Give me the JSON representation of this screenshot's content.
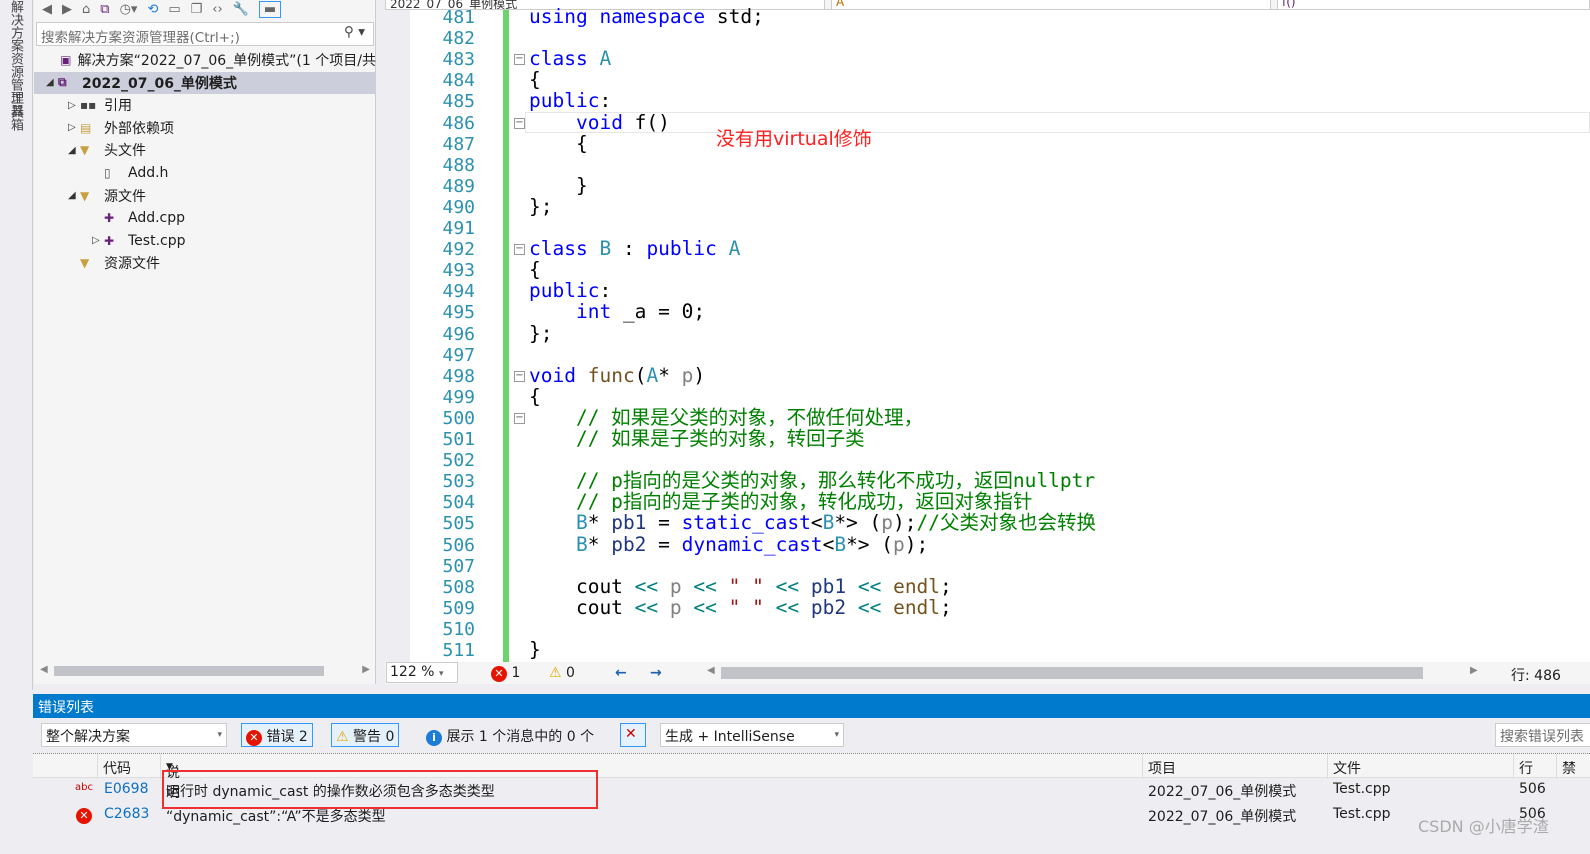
{
  "side_tabs": [
    "解决方案资源管理器",
    "工具箱"
  ],
  "solution_explorer": {
    "search_placeholder": "搜索解决方案资源管理器(Ctrl+;)",
    "tree": [
      {
        "label": "解决方案“2022_07_06_单例模式”(1 个项目/共",
        "icon": "solution-icon",
        "level": 0,
        "twisty": ""
      },
      {
        "label": "2022_07_06_单例模式",
        "icon": "project-icon",
        "level": 0,
        "twisty": "◢",
        "selected": true
      },
      {
        "label": "引用",
        "icon": "references-icon",
        "level": 1,
        "twisty": "▷"
      },
      {
        "label": "外部依赖项",
        "icon": "folder-icon",
        "level": 1,
        "twisty": "▷"
      },
      {
        "label": "头文件",
        "icon": "filter-icon",
        "level": 1,
        "twisty": "◢"
      },
      {
        "label": "Add.h",
        "icon": "header-file-icon",
        "level": 2,
        "twisty": ""
      },
      {
        "label": "源文件",
        "icon": "filter-icon",
        "level": 1,
        "twisty": "◢"
      },
      {
        "label": "Add.cpp",
        "icon": "cpp-file-icon",
        "level": 2,
        "twisty": ""
      },
      {
        "label": "Test.cpp",
        "icon": "cpp-file-icon",
        "level": 2,
        "twisty": "▷"
      },
      {
        "label": "资源文件",
        "icon": "filter-icon",
        "level": 1,
        "twisty": ""
      }
    ]
  },
  "editor": {
    "nav": [
      "2022_07_06_单例模式",
      "A",
      "f()"
    ],
    "annotation": "没有用virtual修饰",
    "lines": [
      {
        "n": "481",
        "t": [
          [
            "using namespace",
            "kw"
          ],
          [
            " std;",
            "tx"
          ]
        ]
      },
      {
        "n": "482",
        "t": []
      },
      {
        "n": "483",
        "fold": true,
        "t": [
          [
            "class",
            "kw"
          ],
          [
            " ",
            "tx"
          ],
          [
            "A",
            "ty"
          ]
        ]
      },
      {
        "n": "484",
        "t": [
          [
            "{",
            "tx"
          ]
        ]
      },
      {
        "n": "485",
        "t": [
          [
            "public",
            "kw"
          ],
          [
            ":",
            "tx"
          ]
        ]
      },
      {
        "n": "486",
        "fold": true,
        "t": [
          [
            "    ",
            "tx"
          ],
          [
            "void",
            "kw"
          ],
          [
            " f()",
            "tx"
          ]
        ]
      },
      {
        "n": "487",
        "t": [
          [
            "    {",
            "tx"
          ]
        ]
      },
      {
        "n": "488",
        "t": []
      },
      {
        "n": "489",
        "t": [
          [
            "    }",
            "tx"
          ]
        ]
      },
      {
        "n": "490",
        "t": [
          [
            "};",
            "tx"
          ]
        ]
      },
      {
        "n": "491",
        "t": []
      },
      {
        "n": "492",
        "fold": true,
        "t": [
          [
            "class",
            "kw"
          ],
          [
            " ",
            "tx"
          ],
          [
            "B",
            "ty"
          ],
          [
            " : ",
            "tx"
          ],
          [
            "public",
            "kw"
          ],
          [
            " ",
            "tx"
          ],
          [
            "A",
            "ty"
          ]
        ]
      },
      {
        "n": "493",
        "t": [
          [
            "{",
            "tx"
          ]
        ]
      },
      {
        "n": "494",
        "t": [
          [
            "public",
            "kw"
          ],
          [
            ":",
            "tx"
          ]
        ]
      },
      {
        "n": "495",
        "t": [
          [
            "    ",
            "tx"
          ],
          [
            "int",
            "kw"
          ],
          [
            " _a = 0;",
            "tx"
          ]
        ]
      },
      {
        "n": "496",
        "t": [
          [
            "};",
            "tx"
          ]
        ]
      },
      {
        "n": "497",
        "t": []
      },
      {
        "n": "498",
        "fold": true,
        "t": [
          [
            "void",
            "kw"
          ],
          [
            " ",
            "tx"
          ],
          [
            "func",
            "fn"
          ],
          [
            "(",
            "tx"
          ],
          [
            "A",
            "ty"
          ],
          [
            "* ",
            "tx"
          ],
          [
            "p",
            "pa"
          ],
          [
            ")",
            "tx"
          ]
        ]
      },
      {
        "n": "499",
        "t": [
          [
            "{",
            "tx"
          ]
        ]
      },
      {
        "n": "500",
        "fold": true,
        "t": [
          [
            "    // 如果是父类的对象，不做任何处理，",
            "cm"
          ]
        ]
      },
      {
        "n": "501",
        "t": [
          [
            "    // 如果是子类的对象，转回子类",
            "cm"
          ]
        ]
      },
      {
        "n": "502",
        "t": []
      },
      {
        "n": "503",
        "t": [
          [
            "    // p指向的是父类的对象，那么转化不成功，返回nullptr",
            "cm"
          ]
        ]
      },
      {
        "n": "504",
        "t": [
          [
            "    // p指向的是子类的对象，转化成功，返回对象指针",
            "cm"
          ]
        ]
      },
      {
        "n": "505",
        "t": [
          [
            "    ",
            "tx"
          ],
          [
            "B",
            "ty"
          ],
          [
            "* ",
            "tx"
          ],
          [
            "pb1",
            "va"
          ],
          [
            " = ",
            "tx"
          ],
          [
            "static_cast",
            "kw"
          ],
          [
            "<",
            "tx"
          ],
          [
            "B",
            "ty"
          ],
          [
            "*> (",
            "tx"
          ],
          [
            "p",
            "pa"
          ],
          [
            ");",
            "tx"
          ],
          [
            "//父类对象也会转换",
            "cm"
          ]
        ]
      },
      {
        "n": "506",
        "t": [
          [
            "    ",
            "tx"
          ],
          [
            "B",
            "ty"
          ],
          [
            "* ",
            "tx"
          ],
          [
            "pb2",
            "va"
          ],
          [
            " = ",
            "tx"
          ],
          [
            "dynamic_cast",
            "kw"
          ],
          [
            "<",
            "tx"
          ],
          [
            "B",
            "ty"
          ],
          [
            "*> (",
            "tx"
          ],
          [
            "p",
            "pa"
          ],
          [
            ");",
            "tx"
          ]
        ]
      },
      {
        "n": "507",
        "t": []
      },
      {
        "n": "508",
        "t": [
          [
            "    cout ",
            "tx"
          ],
          [
            "<<",
            "op"
          ],
          [
            " ",
            "tx"
          ],
          [
            "p",
            "pa"
          ],
          [
            " ",
            "tx"
          ],
          [
            "<<",
            "op"
          ],
          [
            " ",
            "tx"
          ],
          [
            "\" \"",
            "st"
          ],
          [
            " ",
            "tx"
          ],
          [
            "<<",
            "op"
          ],
          [
            " ",
            "tx"
          ],
          [
            "pb1",
            "va"
          ],
          [
            " ",
            "tx"
          ],
          [
            "<<",
            "op"
          ],
          [
            " ",
            "tx"
          ],
          [
            "endl",
            "fn"
          ],
          [
            ";",
            "tx"
          ]
        ]
      },
      {
        "n": "509",
        "t": [
          [
            "    cout ",
            "tx"
          ],
          [
            "<<",
            "op"
          ],
          [
            " ",
            "tx"
          ],
          [
            "p",
            "pa"
          ],
          [
            " ",
            "tx"
          ],
          [
            "<<",
            "op"
          ],
          [
            " ",
            "tx"
          ],
          [
            "\" \"",
            "st"
          ],
          [
            " ",
            "tx"
          ],
          [
            "<<",
            "op"
          ],
          [
            " ",
            "tx"
          ],
          [
            "pb2",
            "va"
          ],
          [
            " ",
            "tx"
          ],
          [
            "<<",
            "op"
          ],
          [
            " ",
            "tx"
          ],
          [
            "endl",
            "fn"
          ],
          [
            ";",
            "tx"
          ]
        ]
      },
      {
        "n": "510",
        "t": []
      },
      {
        "n": "511",
        "t": [
          [
            "}",
            "tx"
          ]
        ]
      }
    ]
  },
  "status": {
    "zoom": "122 %",
    "errors": "1",
    "warnings": "0",
    "line": "行: 486"
  },
  "error_list": {
    "title": "错误列表",
    "scope": "整个解决方案",
    "errors_btn": "错误 2",
    "warnings_btn": "警告 0",
    "messages_btn": "展示 1 个消息中的 0 个",
    "source": "生成 + IntelliSense",
    "search_placeholder": "搜索错误列表",
    "columns": {
      "code": "代码",
      "desc": "说明",
      "project": "项目",
      "file": "文件",
      "line": "行",
      "suppress": "禁"
    },
    "rows": [
      {
        "icon": "intellisense-error-icon",
        "code": "E0698",
        "desc": "运行时 dynamic_cast 的操作数必须包含多态类类型",
        "project": "2022_07_06_单例模式",
        "file": "Test.cpp",
        "line": "506"
      },
      {
        "icon": "error-icon",
        "code": "C2683",
        "desc": "“dynamic_cast”:“A”不是多态类型",
        "project": "2022_07_06_单例模式",
        "file": "Test.cpp",
        "line": "506"
      }
    ]
  },
  "watermark": "CSDN @小唐学渣"
}
